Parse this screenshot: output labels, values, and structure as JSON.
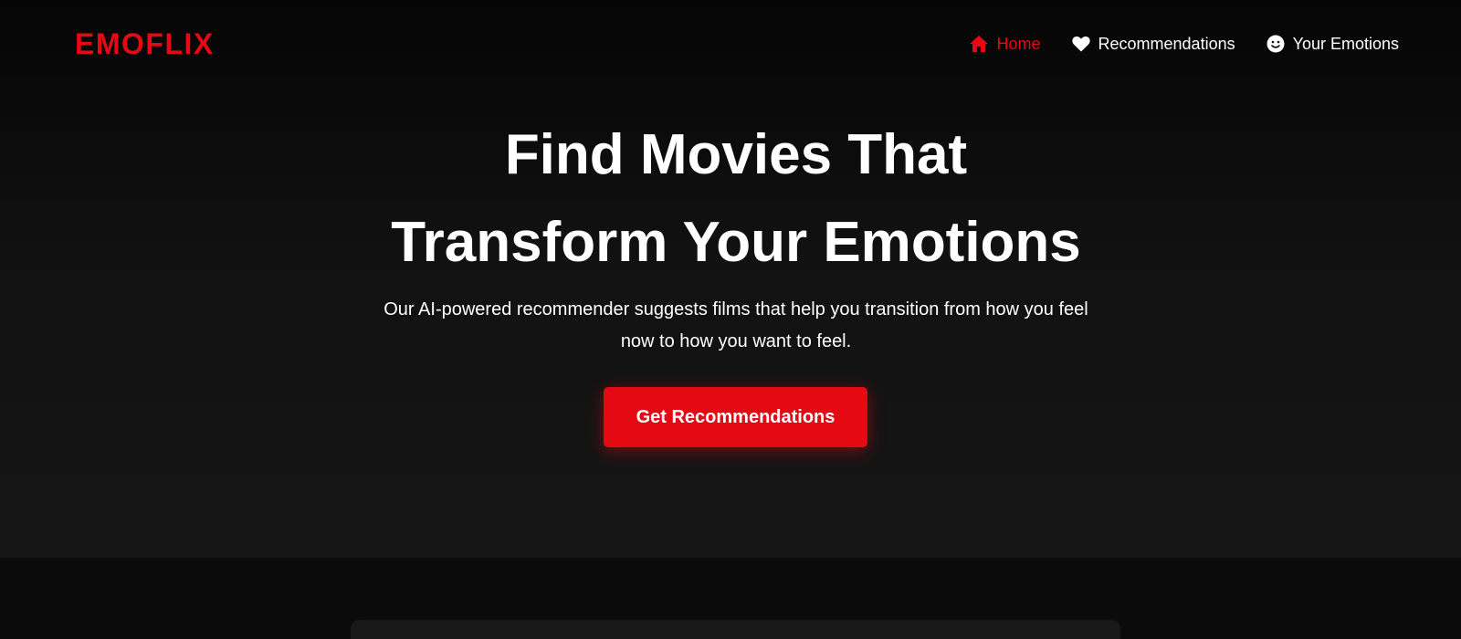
{
  "brand": {
    "logo": "EMOFLIX",
    "accent_color": "#e50914"
  },
  "nav": {
    "items": [
      {
        "label": "Home",
        "icon": "home-icon",
        "active": true
      },
      {
        "label": "Recommendations",
        "icon": "heart-icon",
        "active": false
      },
      {
        "label": "Your Emotions",
        "icon": "smile-icon",
        "active": false
      }
    ]
  },
  "hero": {
    "title_line1": "Find Movies That",
    "title_line2": "Transform Your Emotions",
    "subtitle": "Our AI-powered recommender suggests films that help you transition from how you feel now to how you want to feel.",
    "cta_label": "Get Recommendations"
  }
}
